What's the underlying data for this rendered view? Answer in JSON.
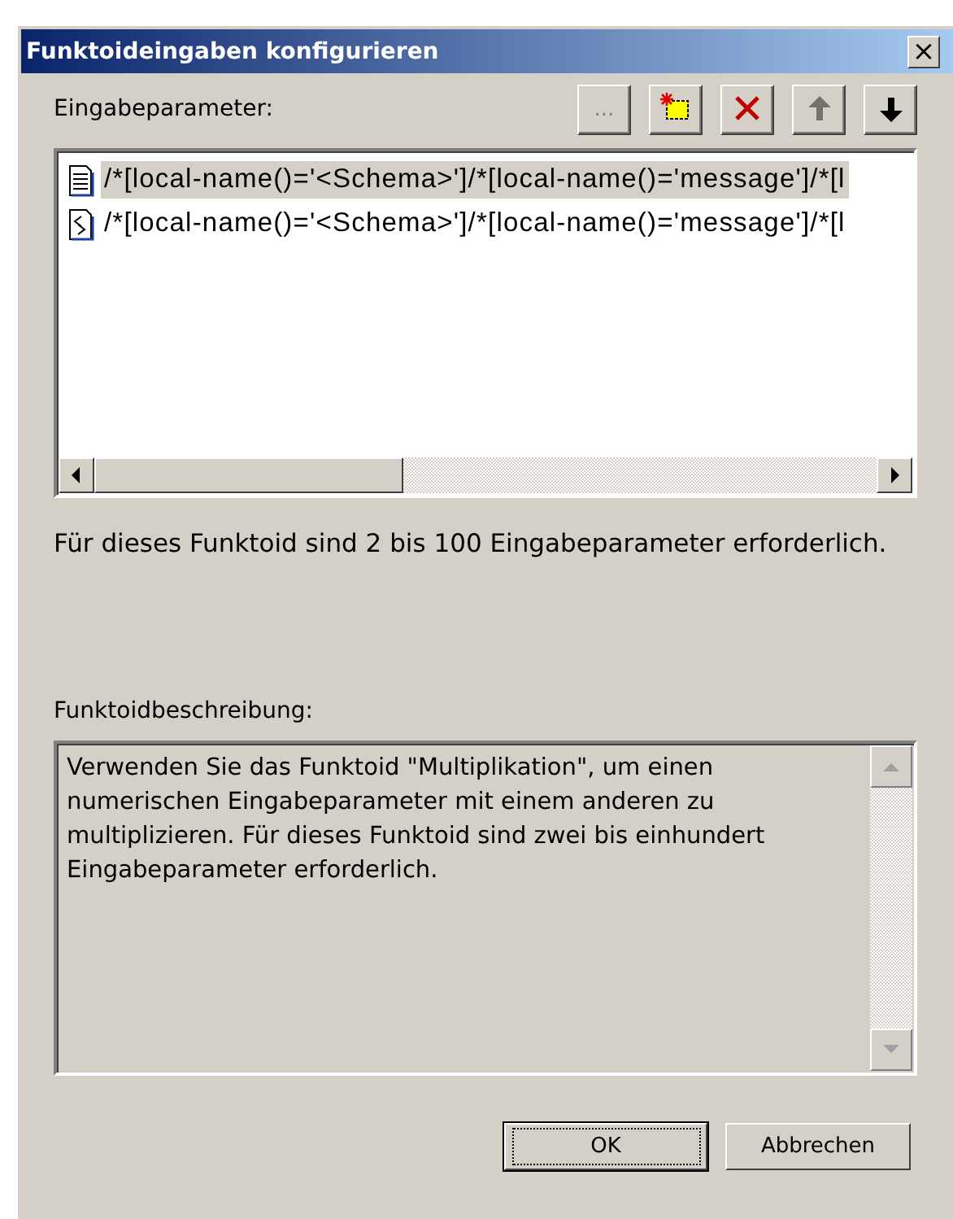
{
  "window": {
    "title": "Funktoideingaben konfigurieren",
    "close": "×"
  },
  "parameters": {
    "label": "Eingabeparameter:",
    "toolbar": [
      {
        "kind": "browse",
        "text": "...",
        "disabled": true
      },
      {
        "kind": "add",
        "disabled": false
      },
      {
        "kind": "delete",
        "disabled": false
      },
      {
        "kind": "up",
        "disabled": true
      },
      {
        "kind": "down",
        "disabled": false
      }
    ],
    "rows": [
      {
        "kind": "document",
        "text": "/*[local-name()='<Schema>']/*[local-name()='message']/*[l",
        "selected": true
      },
      {
        "kind": "script",
        "text": "/*[local-name()='<Schema>']/*[local-name()='message']/*[l",
        "selected": false
      }
    ]
  },
  "requirement": "Für dieses Funktoid sind 2 bis 100 Eingabeparameter erforderlich.",
  "description": {
    "label": "Funktoidbeschreibung:",
    "text": "Verwenden Sie das Funktoid \"Multiplikation\", um einen numerischen Eingabeparameter mit einem anderen zu multiplizieren. Für dieses Funktoid sind zwei bis einhundert Eingabeparameter erforderlich."
  },
  "buttons": [
    {
      "label": "OK",
      "default": true
    },
    {
      "label": "Abbrechen",
      "default": false
    }
  ]
}
